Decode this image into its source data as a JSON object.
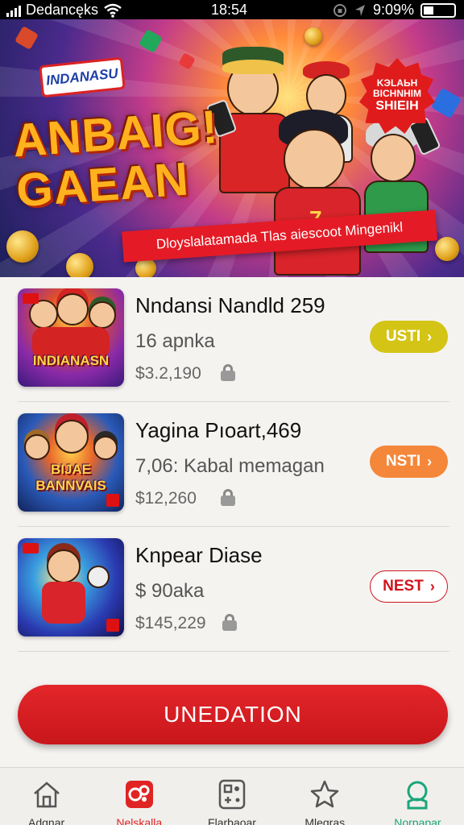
{
  "status_bar": {
    "carrier": "Dedancęks",
    "time": "18:54",
    "battery": "9:09%"
  },
  "banner": {
    "brand": "INDANASU",
    "headline_line1": "ANBAIG!",
    "headline_line2": "GAEAN",
    "sticker_line1": "KЭLAЬH",
    "sticker_line2": "BICHNHIM",
    "sticker_line3": "SHIEIH",
    "ribbon_text": "Dloyslalatamada Tlas aiescoot Mingenikl"
  },
  "items": [
    {
      "title": "Nndansi Nandld 259",
      "subtitle": "16 apnka",
      "price": "$3.2,190",
      "thumb_label_line1": "INDIANASN",
      "thumb_label_line2": "",
      "action": "USTI",
      "chevron": "›",
      "action_bg": "#d4c416",
      "action_fg": "#ffffff"
    },
    {
      "title": "Yagina Pıoart,469",
      "subtitle": "7,06: Kabal memagan",
      "price": "$12,260",
      "thumb_label_line1": "BIJAE",
      "thumb_label_line2": "BANNVAIS",
      "action": "NSTI",
      "chevron": "›",
      "action_bg": "#f4873a",
      "action_fg": "#ffffff"
    },
    {
      "title": "Knpear Diase",
      "subtitle": "$ 90aka",
      "price": "$145,229",
      "thumb_label_line1": "",
      "thumb_label_line2": "",
      "action": "NEST",
      "chevron": "›",
      "action_bg": "#ffffff",
      "action_fg": "#d0141d"
    }
  ],
  "cta": {
    "label": "UNEDATION"
  },
  "nav": [
    {
      "label": "Adgnar",
      "icon": "home-icon",
      "color": "#555555"
    },
    {
      "label": "Nelskalla",
      "icon": "game-icon",
      "color": "#e02424"
    },
    {
      "label": "Flarbaoar",
      "icon": "controller-icon",
      "color": "#555555"
    },
    {
      "label": "Mlegras",
      "icon": "star-icon",
      "color": "#555555"
    },
    {
      "label": "Norpapar",
      "icon": "profile-icon",
      "color": "#1aa67a"
    }
  ],
  "colors": {
    "accent_red": "#d41a20",
    "accent_green": "#1aa67a"
  }
}
